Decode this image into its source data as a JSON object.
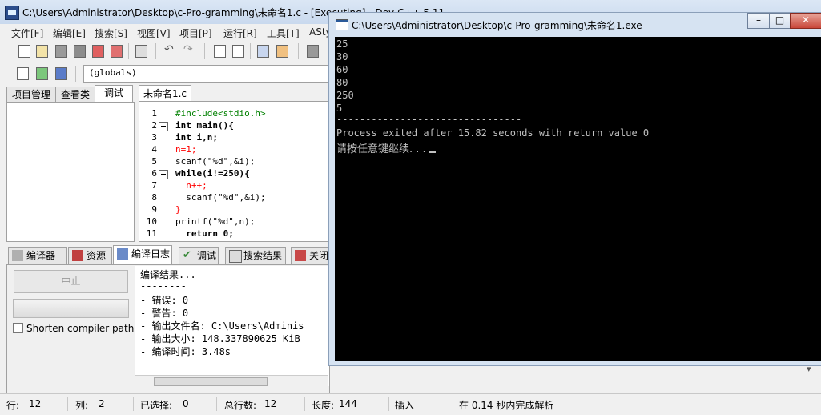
{
  "ide": {
    "title": "C:\\Users\\Administrator\\Desktop\\c-Pro-gramming\\未命名1.c - [Executing] - Dev-C++ 5.11",
    "menu": [
      "文件[F]",
      "编辑[E]",
      "搜索[S]",
      "视图[V]",
      "项目[P]",
      "运行[R]",
      "工具[T]",
      "ASty"
    ],
    "scope_combo": "(globals)",
    "left_tabs": [
      "项目管理",
      "查看类",
      "调试"
    ],
    "editor_tab": "未命名1.c",
    "code": [
      {
        "n": "1",
        "text": "#include<stdio.h>"
      },
      {
        "n": "2",
        "text": "int main(){"
      },
      {
        "n": "3",
        "text": "int i,n;"
      },
      {
        "n": "4",
        "text": "n=1;"
      },
      {
        "n": "5",
        "text": "scanf(\"%d\",&i);"
      },
      {
        "n": "6",
        "text": "while(i!=250){"
      },
      {
        "n": "7",
        "text": "  n++;"
      },
      {
        "n": "8",
        "text": "  scanf(\"%d\",&i);"
      },
      {
        "n": "9",
        "text": "}"
      },
      {
        "n": "10",
        "text": "printf(\"%d\",n);"
      },
      {
        "n": "11",
        "text": "  return 0;"
      }
    ],
    "bottom_tabs": [
      "编译器",
      "资源",
      "编译日志",
      "调试",
      "搜索结果",
      "关闭"
    ],
    "stop_button": "中止",
    "shorten_label": "Shorten compiler paths",
    "log": [
      "编译结果...",
      "--------",
      "- 错误: 0",
      "- 警告: 0",
      "- 输出文件名: C:\\Users\\Adminis",
      "- 输出大小: 148.337890625 KiB",
      "- 编译时间: 3.48s"
    ],
    "status": {
      "row_label": "行:",
      "row": "12",
      "col_label": "列:",
      "col": "2",
      "sel_label": "已选择:",
      "sel": "0",
      "total_label": "总行数:",
      "total": "12",
      "len_label": "长度:",
      "len": "144",
      "mode": "插入",
      "parse": "在 0.14 秒内完成解析"
    }
  },
  "console": {
    "title": "C:\\Users\\Administrator\\Desktop\\c-Pro-gramming\\未命名1.exe",
    "lines": [
      "25",
      "30",
      "60",
      "80",
      "250",
      "5"
    ],
    "divider": "--------------------------------",
    "process_line": "Process exited after 15.82 seconds with return value 0",
    "prompt": "请按任意键继续. . . "
  }
}
